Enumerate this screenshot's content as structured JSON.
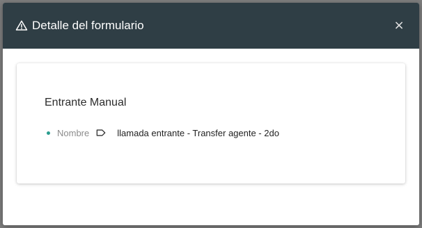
{
  "dialog": {
    "title": "Detalle del formulario",
    "header_icon": "warning-icon",
    "close_label": "×",
    "header_color": "#2f3e45"
  },
  "card": {
    "title": "Entrante Manual",
    "fields": [
      {
        "label": "Nombre",
        "icon": "tag-icon",
        "value": "llamada entrante - Transfer agente - 2do",
        "bullet_color": "#2a9d8f"
      }
    ]
  }
}
